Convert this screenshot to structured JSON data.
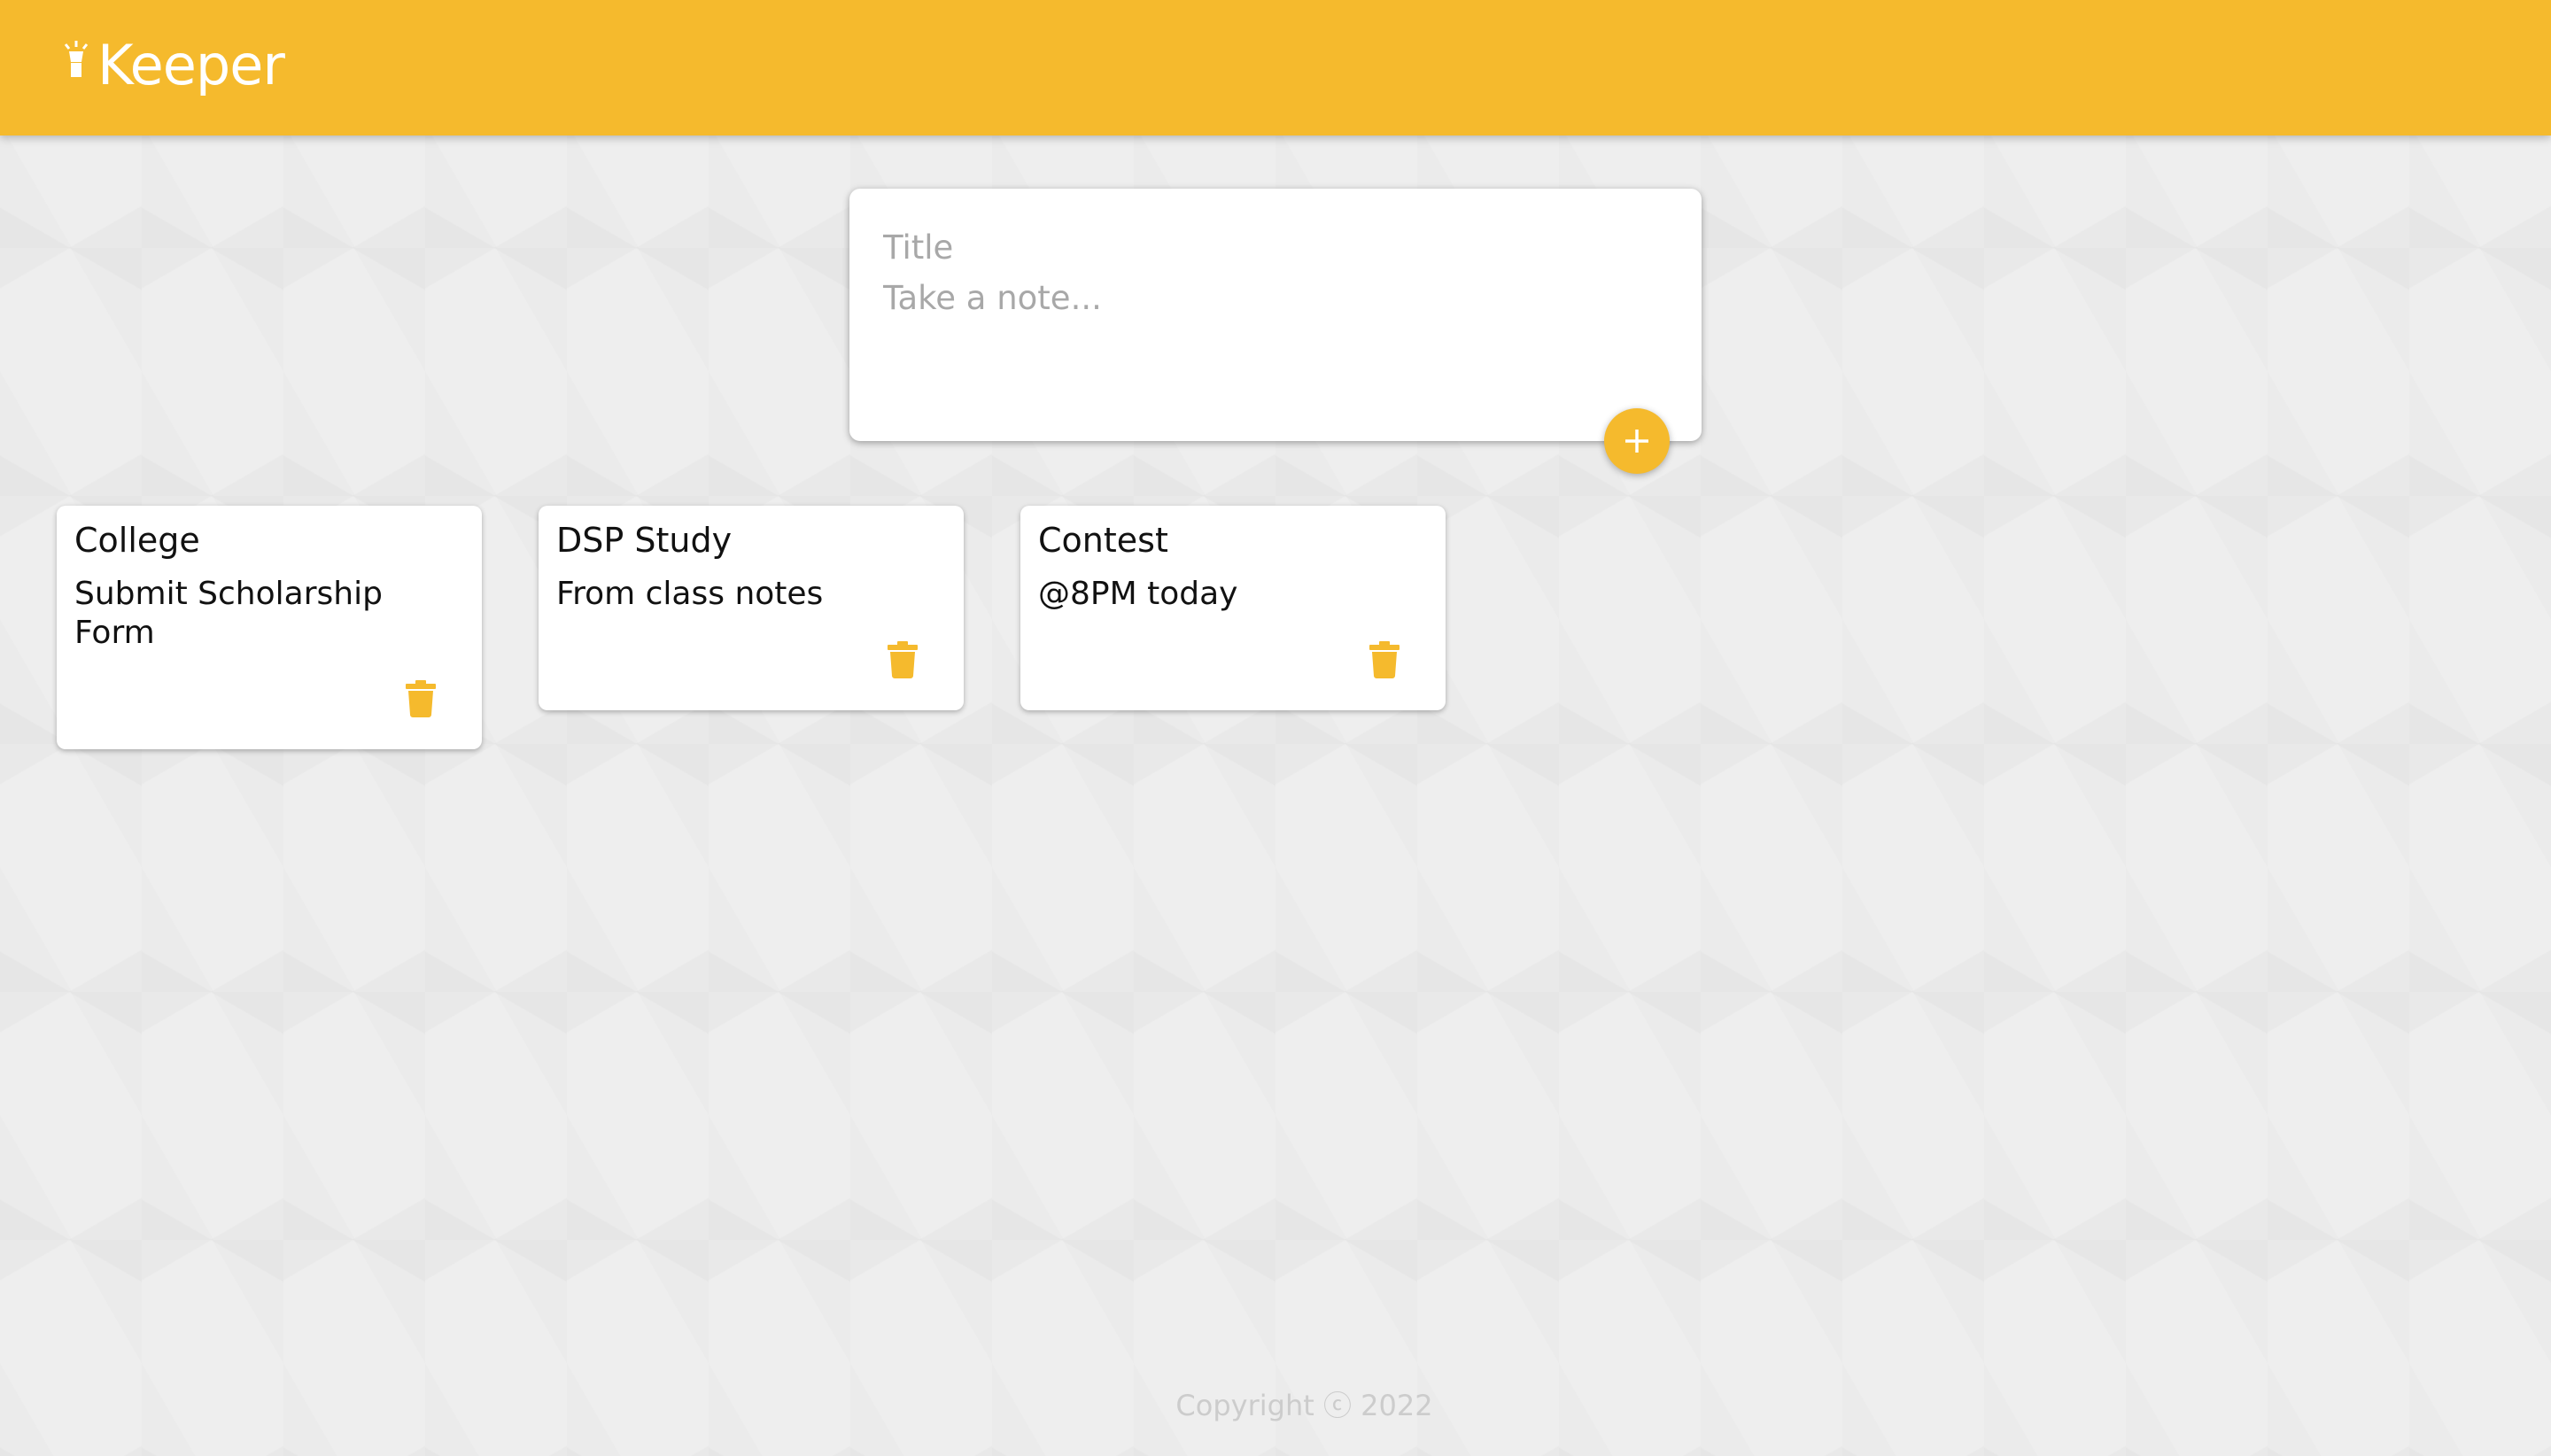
{
  "app": {
    "title": "Keeper",
    "logo_icon": "lightbulb-icon",
    "brand_color": "#f5ba2d"
  },
  "create_note": {
    "title_placeholder": "Title",
    "content_placeholder": "Take a note...",
    "add_icon": "plus-icon"
  },
  "notes": [
    {
      "title": "College",
      "content": "Submit Scholarship Form",
      "delete_icon": "trash-icon"
    },
    {
      "title": "DSP Study",
      "content": "From class notes",
      "delete_icon": "trash-icon"
    },
    {
      "title": "Contest",
      "content": "@8PM today",
      "delete_icon": "trash-icon"
    }
  ],
  "footer": {
    "text": "Copyright ⓒ 2022"
  }
}
